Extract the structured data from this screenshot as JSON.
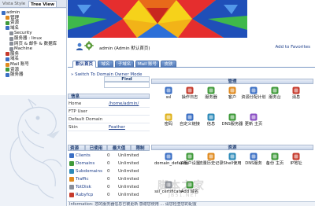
{
  "sidebar": {
    "tab_vista": "Vista Style",
    "tab_tree": "Tree View",
    "tree": [
      {
        "label": "admin",
        "color": "blue",
        "indent": 1
      },
      {
        "label": "管理",
        "color": "orange",
        "indent": 2
      },
      {
        "label": "资源",
        "color": "green",
        "indent": 2
      },
      {
        "label": "域名",
        "color": "blue",
        "indent": 2
      },
      {
        "label": "Security",
        "color": "gray",
        "indent": 3
      },
      {
        "label": "服务器 : linux",
        "color": "gray",
        "indent": 3
      },
      {
        "label": "网页 & 邮件 & 数据库",
        "color": "gray",
        "indent": 3
      },
      {
        "label": "Machine",
        "color": "gray",
        "indent": 3
      },
      {
        "label": "服务",
        "color": "red",
        "indent": 2
      },
      {
        "label": "域名",
        "color": "blue",
        "indent": 2
      },
      {
        "label": "Mail 账号",
        "color": "orange",
        "indent": 2
      },
      {
        "label": "资源",
        "color": "green",
        "indent": 2
      },
      {
        "label": "服务器",
        "color": "blue",
        "indent": 2
      }
    ]
  },
  "header": {
    "user_label": "admin (Admin 默认首页)",
    "add_favorites": "Add to Favorites"
  },
  "tabs": [
    "默认首页",
    "域名",
    "子域名",
    "Mail 账号",
    "皮肤"
  ],
  "left": {
    "switch_link": "Switch To Domain Owner Mode",
    "find_label": "Find",
    "info_header": "信息",
    "info_rows": [
      {
        "k": "Home",
        "v": "/home/admin/"
      },
      {
        "k": "FTP User",
        "v": ""
      },
      {
        "k": "Default Domain",
        "v": ""
      },
      {
        "k": "Skin",
        "v": "Feather"
      }
    ],
    "res_headers": [
      "资源",
      "已使用",
      "最大值",
      "限制"
    ],
    "res_rows": [
      {
        "name": "Clients",
        "used": "0",
        "limit": "Unlimited",
        "color": "#3b6fc4"
      },
      {
        "name": "Domains",
        "used": "0",
        "limit": "Unlimited",
        "color": "#3f9a3a"
      },
      {
        "name": "Subdomains",
        "used": "0",
        "limit": "Unlimited",
        "color": "#2d8ab8"
      },
      {
        "name": "Traffic",
        "used": "0",
        "limit": "Unlimited",
        "color": "#e08a1e"
      },
      {
        "name": "TotDisk",
        "used": "0",
        "limit": "Unlimited",
        "color": "#8a8f99"
      },
      {
        "name": "Rubyfcp",
        "used": "0",
        "limit": "Unlimited",
        "color": "#c63a2c"
      }
    ]
  },
  "manage": {
    "header": "管理",
    "tools": [
      {
        "label": "ssl",
        "color": "#3b6fc4"
      },
      {
        "label": "操作日志",
        "color": "#c63a2c"
      },
      {
        "label": "服务器",
        "color": "#3f9a3a"
      },
      {
        "label": "客户",
        "color": "#e08a1e"
      },
      {
        "label": "资源分配计划",
        "color": "#3b6fc4"
      },
      {
        "label": "服务台",
        "color": "#3f9a3a"
      },
      {
        "label": "消息",
        "color": "#c63a2c"
      },
      {
        "label": "密码",
        "color": "#e0b31e"
      },
      {
        "label": "自定义链接",
        "color": "#3b6fc4"
      },
      {
        "label": "信息",
        "color": "#2d8ab8"
      },
      {
        "label": "DNS服务器",
        "color": "#3f9a3a"
      },
      {
        "label": "更新 主页",
        "color": "#8a4fc4"
      }
    ]
  },
  "resources": {
    "header": "资源",
    "tools": [
      {
        "label": "domain_defaults",
        "color": "#3b6fc4"
      },
      {
        "label": "子服户设置",
        "color": "#3f9a3a"
      },
      {
        "label": "流量历史记录",
        "color": "#e08a1e"
      },
      {
        "label": "Shell使用",
        "color": "#2d8ab8"
      },
      {
        "label": "DNS服务",
        "color": "#3b6fc4"
      },
      {
        "label": "备份 主页",
        "color": "#3f9a3a"
      },
      {
        "label": "IP地址",
        "color": "#c63a2c"
      },
      {
        "label": "ssl_certificate",
        "color": "#8a8f99"
      },
      {
        "label": "Add 域名",
        "color": "#3f9a3a"
      }
    ]
  },
  "watermark": {
    "text": "脚本之家",
    "url": "JB51.NET"
  },
  "bottom_text": "Information: 您的服务器信息已被更新 感谢您使用 ... 请您检查您的配置"
}
